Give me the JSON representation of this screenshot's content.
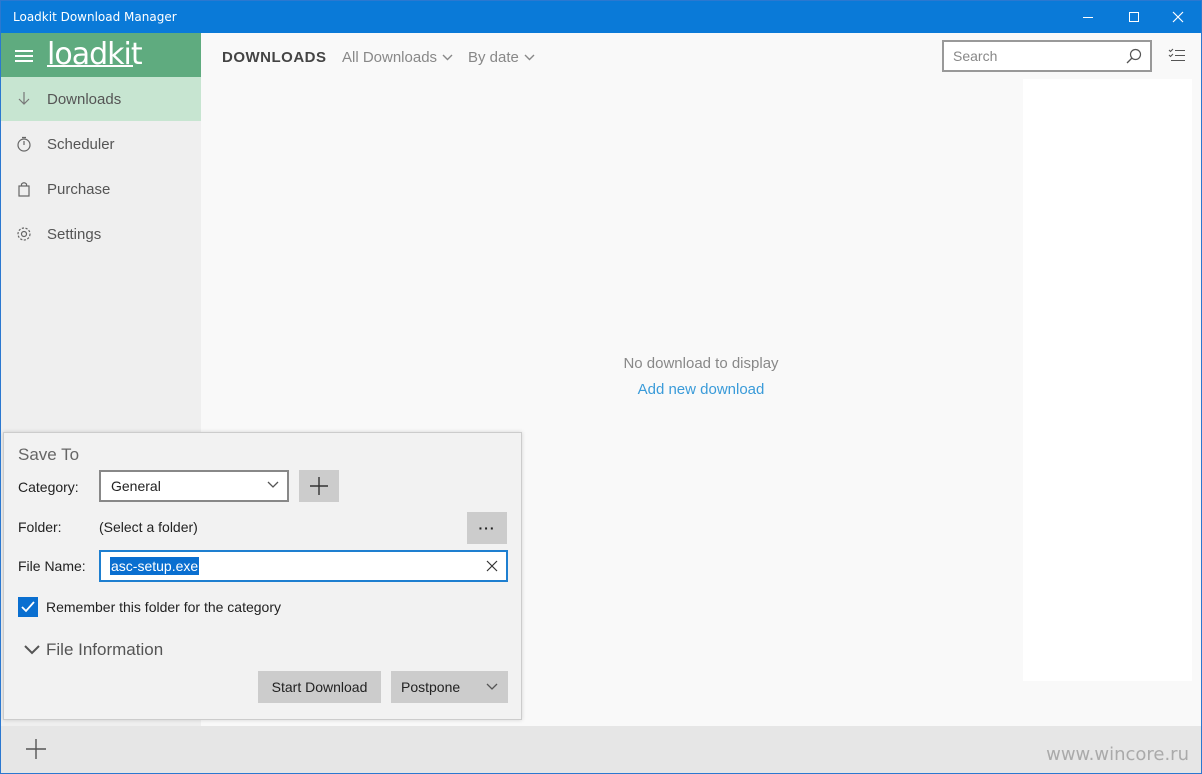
{
  "window": {
    "title": "Loadkit Download Manager"
  },
  "sidebar": {
    "logo": "loadkit",
    "items": [
      {
        "label": "Downloads",
        "icon": "download-icon",
        "active": true
      },
      {
        "label": "Scheduler",
        "icon": "timer-icon",
        "active": false
      },
      {
        "label": "Purchase",
        "icon": "bag-icon",
        "active": false
      },
      {
        "label": "Settings",
        "icon": "gear-icon",
        "active": false
      }
    ]
  },
  "header": {
    "title": "DOWNLOADS",
    "filter": "All Downloads",
    "sort": "By date",
    "search_placeholder": "Search"
  },
  "main": {
    "empty_message": "No download to display",
    "empty_link": "Add new download"
  },
  "popup": {
    "title": "Save To",
    "category_label": "Category:",
    "category_value": "General",
    "folder_label": "Folder:",
    "folder_value": "(Select a folder)",
    "more_label": "···",
    "filename_label": "File Name:",
    "filename_value": "asc-setup.exe",
    "remember_label": "Remember this folder for the category",
    "remember_checked": true,
    "file_info_label": "File Information",
    "start_button": "Start Download",
    "postpone_button": "Postpone"
  },
  "footer": {
    "watermark": "www.wincore.ru"
  },
  "colors": {
    "titlebar": "#0a7ad8",
    "sidebar_header": "#5fab7f",
    "active_item": "#c7e5d1",
    "link": "#3a9bd9",
    "accent": "#0a6fd0"
  }
}
